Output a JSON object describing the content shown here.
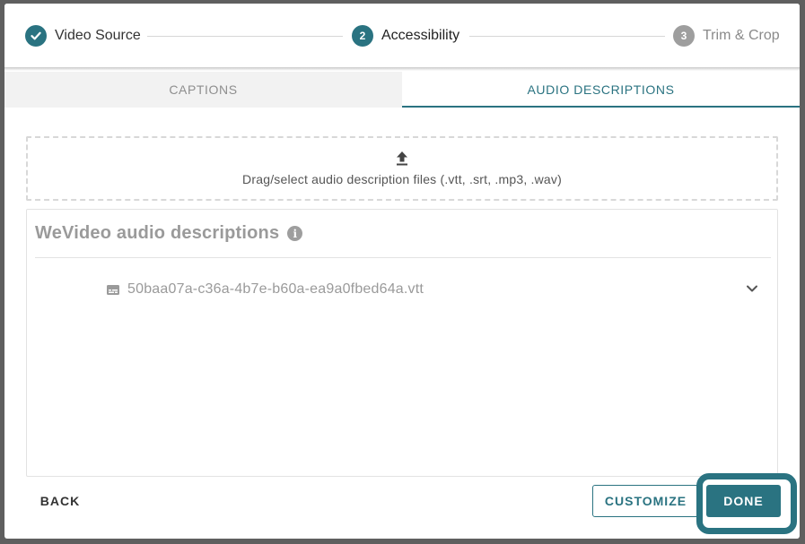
{
  "stepper": {
    "steps": [
      {
        "number": "1",
        "label": "Video Source",
        "state": "completed",
        "icon": "check-icon"
      },
      {
        "number": "2",
        "label": "Accessibility",
        "state": "active"
      },
      {
        "number": "3",
        "label": "Trim & Crop",
        "state": "pending"
      }
    ]
  },
  "tabs": {
    "captions_label": "CAPTIONS",
    "audio_label": "AUDIO DESCRIPTIONS",
    "active": "AUDIO DESCRIPTIONS"
  },
  "upload": {
    "icon": "upload-icon",
    "text": "Drag/select audio description files (.vtt, .srt, .mp3, .wav)"
  },
  "descriptions": {
    "title": "WeVideo audio descriptions",
    "info_icon": "info-icon",
    "files": [
      {
        "name": "50baa07a-c36a-4b7e-b60a-ea9a0fbed64a.vtt",
        "icon": "subtitles-icon",
        "expand_icon": "chevron-down-icon"
      }
    ]
  },
  "footer": {
    "back_label": "BACK",
    "customize_label": "CUSTOMIZE",
    "done_label": "DONE"
  },
  "colors": {
    "accent": "#2a7381",
    "overlay": "#5f5f5f",
    "inactive_step": "#9e9e9e",
    "inactive_tab_bg": "#f2f2f2"
  }
}
